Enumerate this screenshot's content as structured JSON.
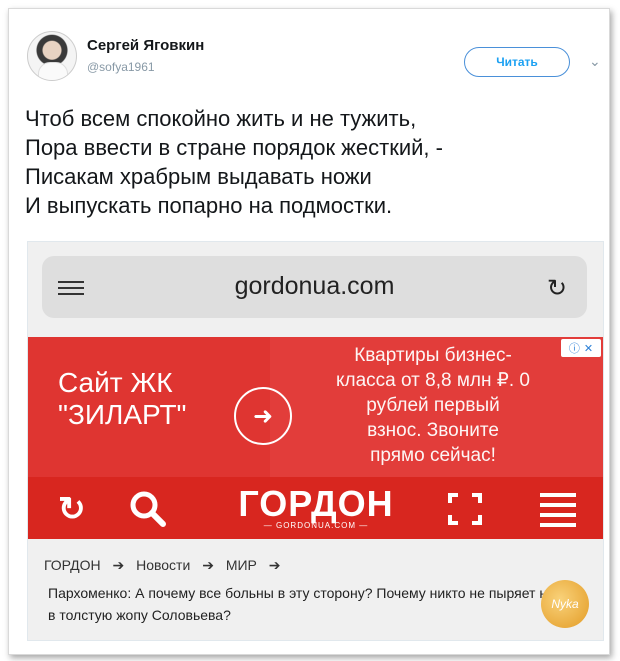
{
  "tweet": {
    "author_name": "Сергей Яговкин",
    "author_handle": "@sofya1961",
    "follow_label": "Читать",
    "lines": [
      "Чтоб всем спокойно жить и не тужить,",
      "Пора ввести в стране порядок жесткий, -",
      "Писакам храбрым выдавать ножи",
      "И выпускать попарно на подмостки."
    ]
  },
  "browser": {
    "url": "gordonua.com"
  },
  "ad": {
    "title_line1": "Сайт ЖК",
    "title_line2": "\"ЗИЛАРТ\"",
    "text_lines": [
      "Квартиры бизнес-",
      "класса от 8,8 млн ₽. 0",
      "рублей первый",
      "взнос. Звоните",
      "прямо сейчас!"
    ],
    "choices_i": "ⓘ",
    "choices_x": "✕"
  },
  "site": {
    "logo": "ГОРДОН",
    "logo_sub": "— GORDONUA.COM —",
    "breadcrumbs": [
      "ГОРДОН",
      "Новости",
      "МИР"
    ],
    "breadcrumb_sep": "➔",
    "headline": "Пархоменко: А почему все больны в эту сторону? Почему никто не пыряет ножом в толстую жопу Соловьева?"
  },
  "watermark": "Nyka",
  "colors": {
    "ad_red": "#e23d3a",
    "nav_red": "#d8261f",
    "follow_blue": "#1da1f2"
  }
}
